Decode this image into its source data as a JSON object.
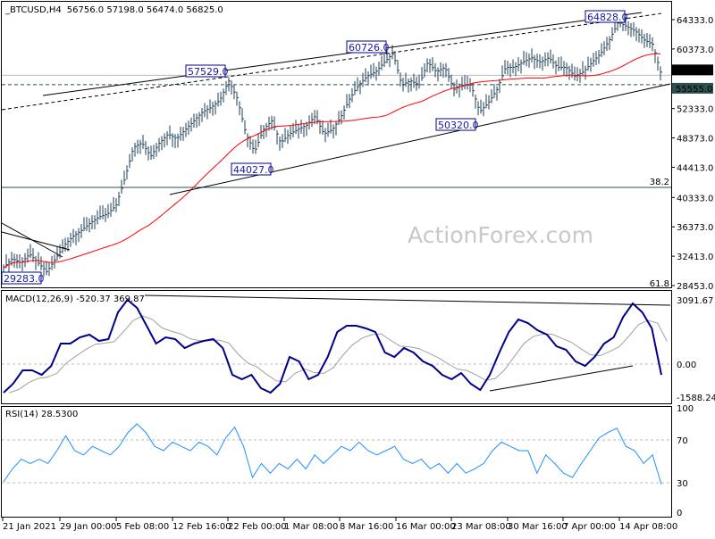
{
  "header": {
    "symbol": "_BTCUSD,H4",
    "ohlc": "56756.0 57198.0 56474.0 56825.0"
  },
  "watermark": "ActionForex.com",
  "colors": {
    "bars": "#1d3f57",
    "ma": "#ff0000",
    "macd": "#00008b",
    "signal": "#a0a0a0",
    "rsi": "#1e90ff",
    "label_border": "#00008b",
    "label_text": "#1a1aa0",
    "current_tag": "#000000",
    "level_tag": "#2f4f4f"
  },
  "chart_data": [
    {
      "type": "line",
      "title": "_BTCUSD,H4",
      "x_ticks": [
        "21 Jan 2021",
        "29 Jan 00:00",
        "5 Feb 08:00",
        "12 Feb 16:00",
        "22 Feb 00:00",
        "1 Mar 08:00",
        "8 Mar 16:00",
        "16 Mar 00:00",
        "23 Mar 08:00",
        "30 Mar 16:00",
        "7 Apr 00:00",
        "14 Apr 08:00"
      ],
      "y_ticks": [
        "64333.0",
        "60373.0",
        "52333.0",
        "48373.0",
        "44413.0",
        "40333.0",
        "36373.0",
        "32413.0",
        "28453.0"
      ],
      "ylim": [
        28453,
        64333
      ],
      "close": [
        30900,
        32100,
        31500,
        32700,
        31500,
        30300,
        32100,
        33900,
        35100,
        35900,
        36900,
        37700,
        38100,
        39300,
        42900,
        47100,
        47700,
        45900,
        47700,
        48900,
        48300,
        49500,
        50700,
        51900,
        52500,
        53500,
        56100,
        53700,
        48900,
        46500,
        49500,
        50700,
        47700,
        48900,
        49500,
        50100,
        51300,
        48900,
        49500,
        51300,
        53700,
        55500,
        56700,
        57300,
        58600,
        59800,
        55500,
        56100,
        55500,
        58600,
        57300,
        57900,
        54900,
        55500,
        55500,
        51900,
        53100,
        54900,
        57900,
        57900,
        58600,
        59200,
        58600,
        59200,
        57900,
        57900,
        56700,
        57300,
        58600,
        59800,
        61600,
        64000,
        63400,
        62800,
        61600,
        61000,
        56825
      ],
      "price_labels": [
        "57529.0",
        "60726.0",
        "64828.0",
        "44027.0",
        "50320.0",
        "29283.0"
      ],
      "current_price": {
        "label": "56825.0",
        "value": 56825
      },
      "level": {
        "label": "55555.0",
        "value": 55555
      },
      "fib_levels": [
        {
          "label": "38.2",
          "value": 41700
        },
        {
          "label": "61.8",
          "value": 28453
        }
      ]
    },
    {
      "type": "line",
      "title": "MACD(12,26,9) -520.37 369.87",
      "y_ticks": [
        "3091.67",
        "0.00",
        "-1588.24"
      ],
      "macd": [
        -1373,
        -944,
        -300,
        -300,
        -515,
        -86,
        987,
        987,
        1287,
        1416,
        1115,
        1201,
        2488,
        3091,
        2703,
        1845,
        987,
        1287,
        1201,
        772,
        987,
        1115,
        1201,
        772,
        -515,
        -729,
        -515,
        -1158,
        -1373,
        -944,
        343,
        129,
        -729,
        -515,
        343,
        1544,
        1845,
        1845,
        1716,
        1544,
        558,
        343,
        772,
        558,
        129,
        -86,
        -515,
        -729,
        -429,
        -944,
        -1244,
        -515,
        558,
        1544,
        2145,
        1973,
        1630,
        1416,
        858,
        686,
        129,
        -86,
        343,
        987,
        1287,
        2274,
        2917,
        2488,
        1716,
        -520
      ]
    },
    {
      "type": "line",
      "title": "RSI(14) 28.5300",
      "y_ticks": [
        "100",
        "70",
        "30",
        "0"
      ],
      "ylim": [
        0,
        100
      ],
      "levels": [
        70,
        30
      ],
      "rsi": [
        31,
        43,
        52,
        48,
        52,
        48,
        60,
        74,
        60,
        56,
        64,
        60,
        56,
        64,
        77,
        85,
        77,
        64,
        60,
        68,
        64,
        60,
        68,
        64,
        56,
        72,
        82,
        64,
        35,
        48,
        39,
        48,
        43,
        52,
        43,
        56,
        48,
        56,
        64,
        60,
        68,
        60,
        56,
        60,
        64,
        52,
        48,
        52,
        43,
        48,
        39,
        48,
        39,
        43,
        48,
        60,
        68,
        64,
        60,
        60,
        39,
        56,
        48,
        39,
        35,
        48,
        60,
        72,
        77,
        81,
        64,
        60,
        48,
        56,
        28.53
      ]
    }
  ]
}
